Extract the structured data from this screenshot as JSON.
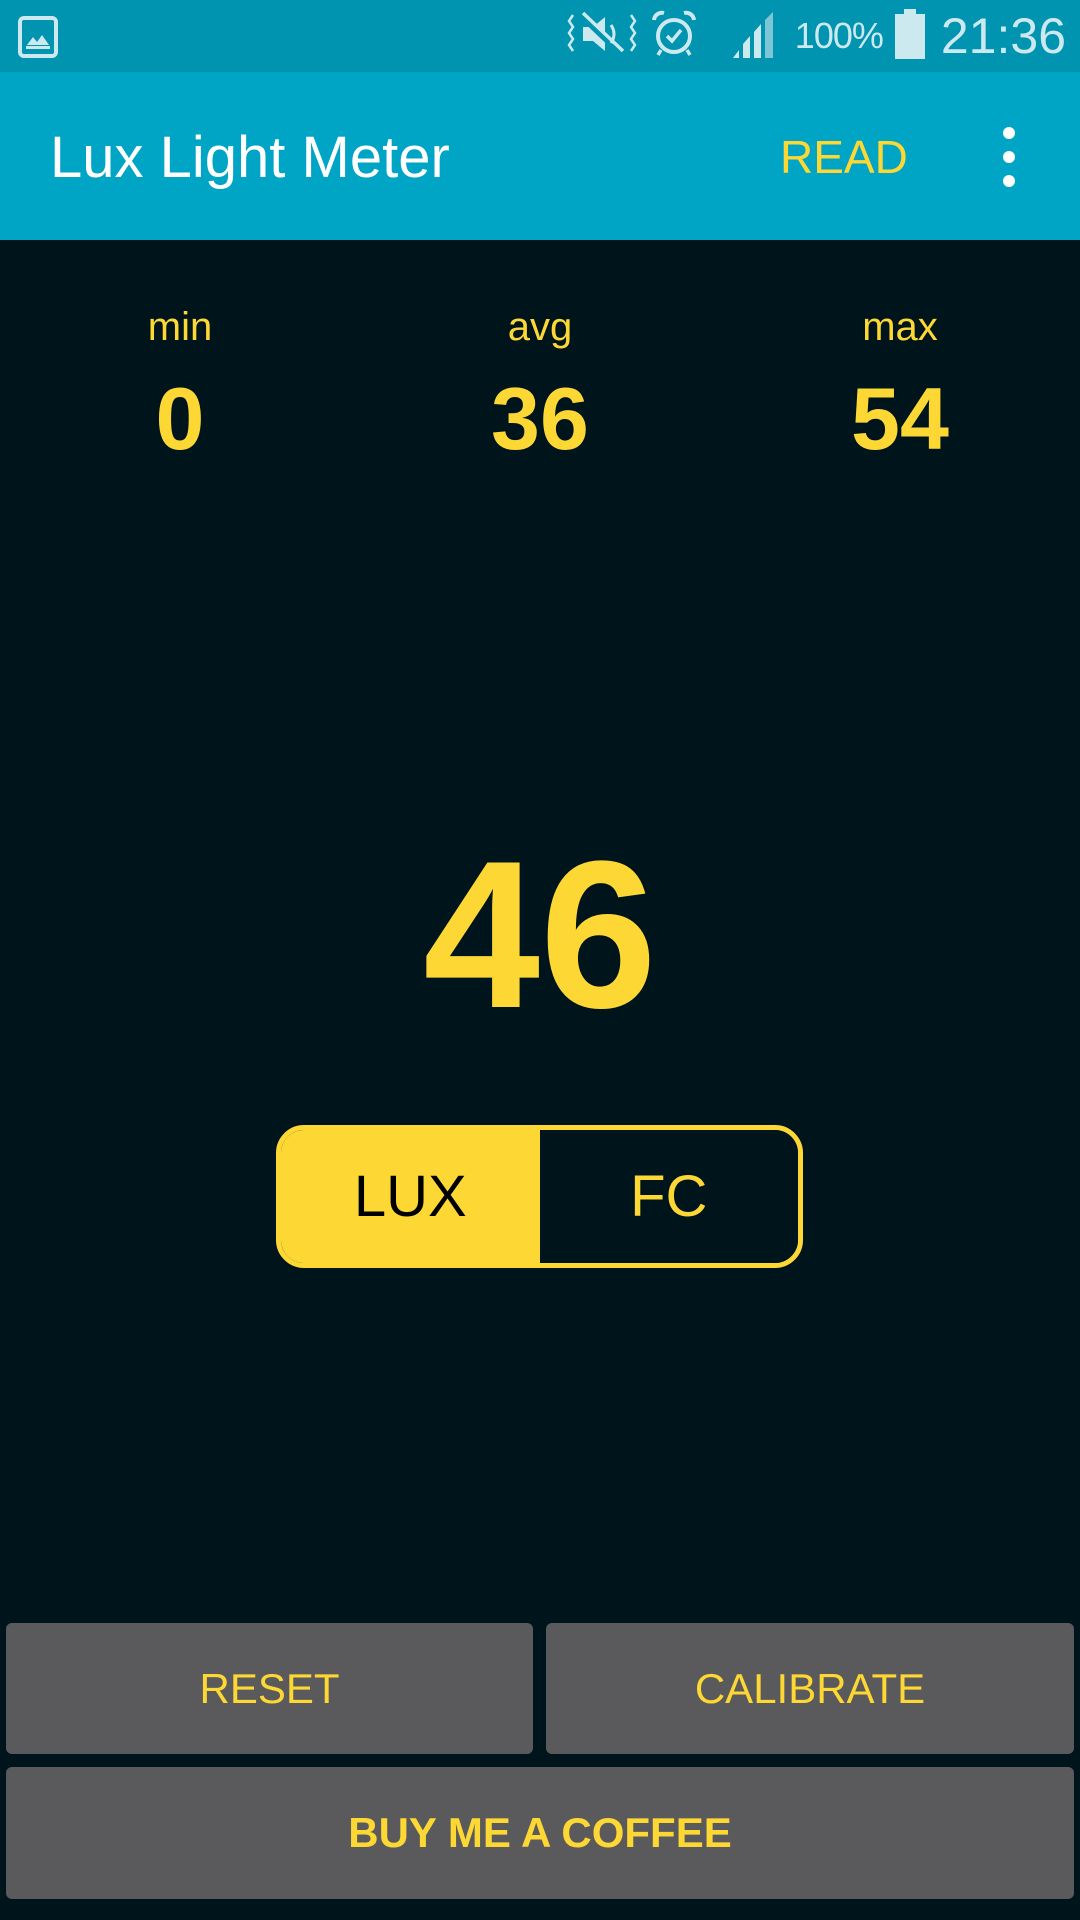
{
  "status_bar": {
    "left_icons": [
      "gallery-notification-icon"
    ],
    "right_icons": [
      "vibrate-mute-icon",
      "alarm-icon",
      "signal-icon",
      "battery-icon"
    ],
    "battery_percent": "100%",
    "time": "21:36"
  },
  "app_bar": {
    "title": "Lux Light Meter",
    "read_label": "READ",
    "overflow_icon": "more-vert-icon"
  },
  "stats": {
    "min": {
      "label": "min",
      "value": "0"
    },
    "avg": {
      "label": "avg",
      "value": "36"
    },
    "max": {
      "label": "max",
      "value": "54"
    }
  },
  "reading": {
    "value": "46"
  },
  "unit_toggle": {
    "options": [
      {
        "label": "LUX",
        "selected": true
      },
      {
        "label": "FC",
        "selected": false
      }
    ]
  },
  "buttons": {
    "reset": "RESET",
    "calibrate": "CALIBRATE",
    "coffee": "BUY ME A COFFEE"
  },
  "colors": {
    "status_bar": "#0094b0",
    "app_bar": "#00a5c6",
    "background": "#00141c",
    "accent": "#fdd835",
    "button": "#5a5a5c"
  }
}
